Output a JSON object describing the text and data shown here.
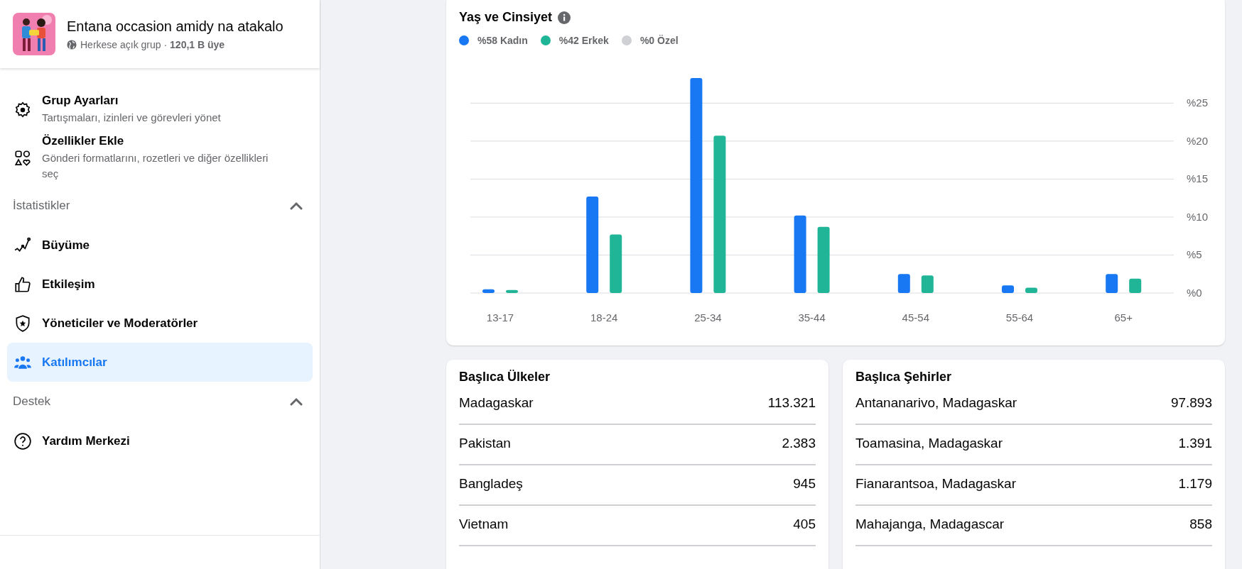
{
  "group": {
    "name": "Entana occasion amidy na atakalo",
    "meta": "Herkese açık grup · **120,1 B üye**"
  },
  "sidebar": {
    "sections": [
      {
        "items": [
          {
            "kind": "gear",
            "label": "Grup Ayarları",
            "description": "Tartışmaları, izinleri ve görevleri yönet",
            "selected": false
          },
          {
            "kind": "shapes",
            "label": "Özellikler Ekle",
            "description": "Gönderi formatlarını, rozetleri ve diğer özellikleri seç",
            "selected": false
          }
        ]
      },
      {
        "title": "İstatistikler",
        "expanded": true,
        "items": [
          {
            "kind": "growth",
            "label": "Büyüme",
            "selected": false
          },
          {
            "kind": "like",
            "label": "Etkileşim",
            "selected": false
          },
          {
            "kind": "shield",
            "label": "Yöneticiler ve Moderatörler",
            "selected": false
          },
          {
            "kind": "people",
            "label": "Katılımcılar",
            "selected": true
          }
        ]
      },
      {
        "title": "Destek",
        "expanded": true,
        "items": [
          {
            "kind": "help",
            "label": "Yardım Merkezi",
            "selected": false
          }
        ]
      }
    ]
  },
  "age_gender": {
    "title": "Yaş ve Cinsiyet",
    "extra_legend": [
      {
        "label": "%0 Özel",
        "color": "#ced0d4"
      }
    ],
    "chart_data": {
      "type": "bar",
      "grid": true,
      "categories": [
        "13-17",
        "18-24",
        "25-34",
        "35-44",
        "45-54",
        "55-64",
        "65+"
      ],
      "series": [
        {
          "name": "%58 Kadın",
          "color": "#1877f2",
          "values": [
            0.5,
            12.7,
            28.3,
            10.2,
            2.5,
            1.0,
            2.5
          ]
        },
        {
          "name": "%42 Erkek",
          "color": "#1fb596",
          "values": [
            0.4,
            7.7,
            20.7,
            8.7,
            2.3,
            0.7,
            1.9
          ]
        }
      ],
      "ylim": [
        0,
        28.3
      ],
      "yticks": [
        {
          "value": 0,
          "label": "%0"
        },
        {
          "value": 5,
          "label": "%5"
        },
        {
          "value": 10,
          "label": "%10"
        },
        {
          "value": 15,
          "label": "%15"
        },
        {
          "value": 20,
          "label": "%20"
        },
        {
          "value": 25,
          "label": "%25"
        }
      ]
    }
  },
  "top_countries": {
    "title": "Başlıca Ülkeler",
    "rows": [
      {
        "name": "Madagaskar",
        "count": "113.321"
      },
      {
        "name": "Pakistan",
        "count": "2.383"
      },
      {
        "name": "Bangladeş",
        "count": "945"
      },
      {
        "name": "Vietnam",
        "count": "405"
      }
    ]
  },
  "top_cities": {
    "title": "Başlıca Şehirler",
    "rows": [
      {
        "name": "Antananarivo, Madagaskar",
        "count": "97.893"
      },
      {
        "name": "Toamasina, Madagaskar",
        "count": "1.391"
      },
      {
        "name": "Fianarantsoa, Madagaskar",
        "count": "1.179"
      },
      {
        "name": "Mahajanga, Madagascar",
        "count": "858"
      }
    ]
  }
}
